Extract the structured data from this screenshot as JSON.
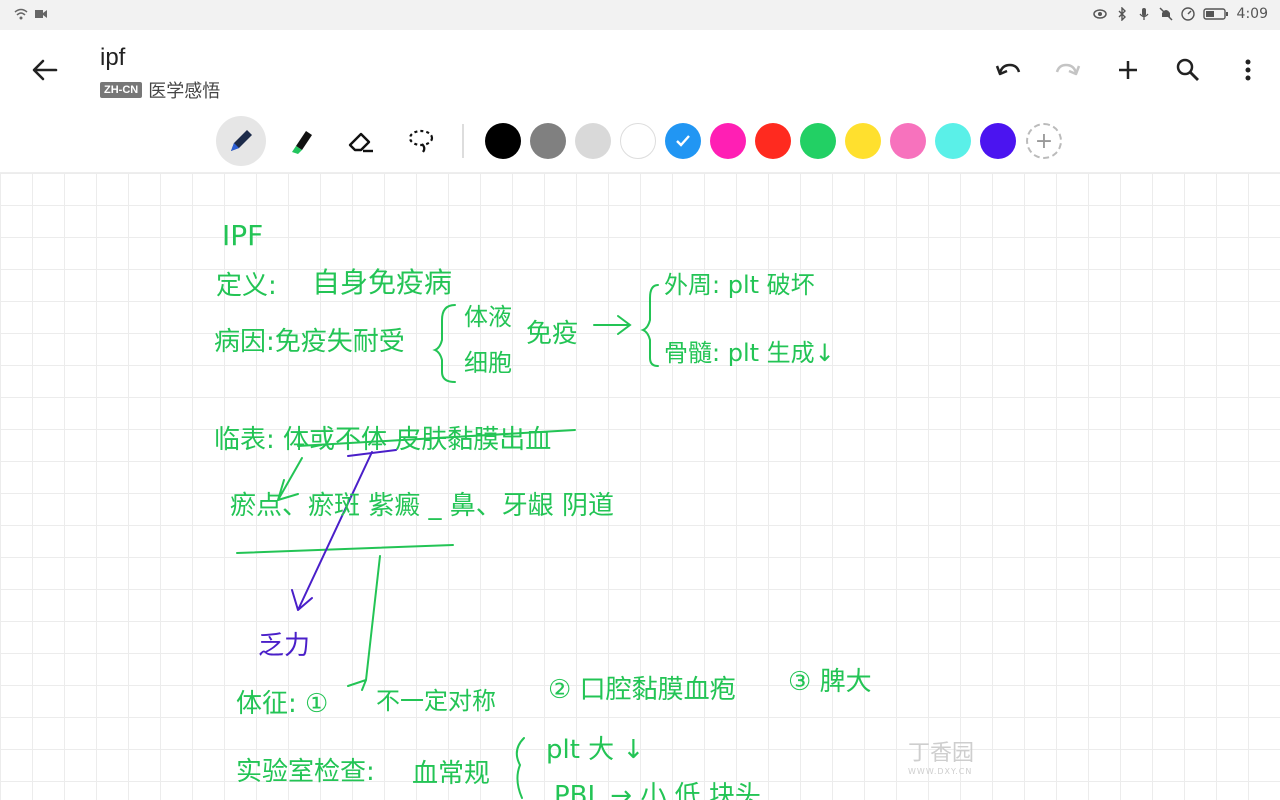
{
  "status_bar": {
    "time": "4:09"
  },
  "app_bar": {
    "title": "ipf",
    "language_badge": "ZH-CN",
    "notebook": "医学感悟"
  },
  "toolbar": {
    "tools": [
      "pen-icon",
      "highlighter-icon",
      "eraser-icon",
      "lasso-icon"
    ],
    "active_tool": "pen-icon",
    "colors": [
      "#000000",
      "#808080",
      "#d9d9d9",
      "#ffffff",
      "#2196f3",
      "#ff1fb4",
      "#ff2a1f",
      "#22d064",
      "#ffe02e",
      "#f772bd",
      "#5af0e8",
      "#4b14f0"
    ],
    "selected_color": "#2196f3"
  },
  "note": {
    "line1": "IPF",
    "line2_label": "定义:",
    "line2_value": "自身免疫病",
    "line3_label": "病因:免疫失耐受",
    "line3_b1": "体液",
    "line3_b2": "细胞",
    "line3_immune": "免疫",
    "line3_arrow": "→",
    "line3_r1": "外周: plt 破坏",
    "line3_r2": "骨髓: plt 生成↓",
    "line4": "临表: 体或不体 皮肤黏膜出血",
    "line5": "瘀点、瘀斑 紫癜 _ 鼻、牙龈 阴道",
    "line6": "乏力",
    "line7_label": "体征: ①",
    "line7_value": "不一定对称",
    "line7_b": "② 口腔黏膜血疱",
    "line7_c": "③ 脾大",
    "line8_label": "实验室检查:",
    "line8_value": "血常规",
    "line8_r1": "plt 大 ↓",
    "line8_r2": "PBL → 小 低  块头"
  },
  "watermark": {
    "text": "丁香园",
    "url": "WWW.DXY.CN"
  }
}
